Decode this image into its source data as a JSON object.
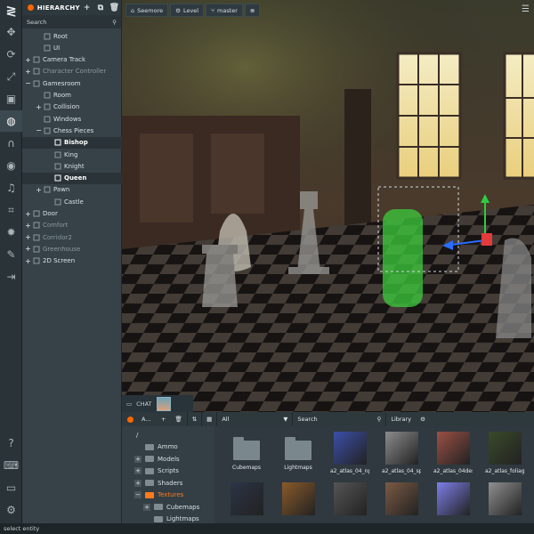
{
  "toolbar": {
    "logo": "≷",
    "tools": [
      "move-tool",
      "rotate-tool",
      "scale-tool",
      "resize-tool",
      "world-tool",
      "magnet-tool",
      "preview-tool",
      "code-tool",
      "crop-tool",
      "light-tool",
      "edit-tool",
      "exit-tool",
      "help-tool",
      "keyboard-tool",
      "chat-tool",
      "settings-tool"
    ]
  },
  "hierarchy": {
    "title": "HIERARCHY",
    "add": "+",
    "copy": "⧉",
    "delete": "🗑",
    "search_placeholder": "Search",
    "nodes": [
      {
        "label": "Root",
        "expander": "",
        "selected": false,
        "disabled": false
      },
      {
        "label": "UI",
        "expander": "",
        "selected": false,
        "disabled": false
      },
      {
        "label": "Camera Track",
        "expander": "+",
        "selected": false,
        "disabled": false
      },
      {
        "label": "Character Controller",
        "expander": "+",
        "selected": false,
        "disabled": true
      },
      {
        "label": "Gamesroom",
        "expander": "−",
        "selected": false,
        "disabled": false
      },
      {
        "label": "Room",
        "expander": "",
        "selected": false,
        "disabled": false
      },
      {
        "label": "Collision",
        "expander": "+",
        "selected": false,
        "disabled": false
      },
      {
        "label": "Windows",
        "expander": "",
        "selected": false,
        "disabled": false
      },
      {
        "label": "Chess Pieces",
        "expander": "−",
        "selected": false,
        "disabled": false
      },
      {
        "label": "Bishop",
        "expander": "",
        "selected": true,
        "disabled": false
      },
      {
        "label": "King",
        "expander": "",
        "selected": false,
        "disabled": false
      },
      {
        "label": "Knight",
        "expander": "",
        "selected": false,
        "disabled": false
      },
      {
        "label": "Queen",
        "expander": "",
        "selected": true,
        "disabled": false
      },
      {
        "label": "Pawn",
        "expander": "+",
        "selected": false,
        "disabled": false
      },
      {
        "label": "Castle",
        "expander": "",
        "selected": false,
        "disabled": false
      },
      {
        "label": "Door",
        "expander": "+",
        "selected": false,
        "disabled": false
      },
      {
        "label": "Comfort",
        "expander": "+",
        "selected": false,
        "disabled": true
      },
      {
        "label": "Corridor2",
        "expander": "+",
        "selected": false,
        "disabled": true
      },
      {
        "label": "Greenhouse",
        "expander": "+",
        "selected": false,
        "disabled": true
      },
      {
        "label": "2D Screen",
        "expander": "+",
        "selected": false,
        "disabled": false
      }
    ]
  },
  "viewport": {
    "project": "Seemore",
    "scene": "Level",
    "branch": "master",
    "menu": "☰"
  },
  "chat": {
    "label": "CHAT"
  },
  "assets": {
    "title": "A...",
    "add": "+",
    "delete": "🗑",
    "sort": "⇅",
    "view": "▦",
    "filter": "All",
    "filter_arrow": "▼",
    "search_placeholder": "Search",
    "library": "Library",
    "settings": "⚙",
    "tree": [
      {
        "label": "/",
        "expander": "",
        "selected": false
      },
      {
        "label": "Ammo",
        "expander": "",
        "selected": false
      },
      {
        "label": "Models",
        "expander": "+",
        "selected": false
      },
      {
        "label": "Scripts",
        "expander": "+",
        "selected": false
      },
      {
        "label": "Shaders",
        "expander": "+",
        "selected": false
      },
      {
        "label": "Textures",
        "expander": "−",
        "selected": true
      },
      {
        "label": "Cubemaps",
        "expander": "+",
        "selected": false
      },
      {
        "label": "Lightmaps",
        "expander": "",
        "selected": false
      }
    ],
    "items": [
      {
        "name": "Cubemaps",
        "kind": "folder",
        "color": ""
      },
      {
        "name": "Lightmaps",
        "kind": "folder",
        "color": ""
      },
      {
        "name": "a2_atlas_04_np...",
        "kind": "texture",
        "color": "#3b4fa8"
      },
      {
        "name": "a2_atlas_04_sp...",
        "kind": "texture",
        "color": "#8c8c8c"
      },
      {
        "name": "a2_atlas_04desa...",
        "kind": "texture",
        "color": "#9a5045"
      },
      {
        "name": "a2_atlas_foliage...",
        "kind": "texture",
        "color": "#3a4a2a"
      },
      {
        "name": "",
        "kind": "texture",
        "color": "#2c3446"
      },
      {
        "name": "",
        "kind": "texture",
        "color": "#8a5a2a"
      },
      {
        "name": "",
        "kind": "texture",
        "color": "#555555"
      },
      {
        "name": "",
        "kind": "texture",
        "color": "#7a5a44"
      },
      {
        "name": "",
        "kind": "texture",
        "color": "#7d7ee8"
      },
      {
        "name": "",
        "kind": "texture",
        "color": "#909090"
      }
    ]
  },
  "status": {
    "text": "select entity"
  }
}
